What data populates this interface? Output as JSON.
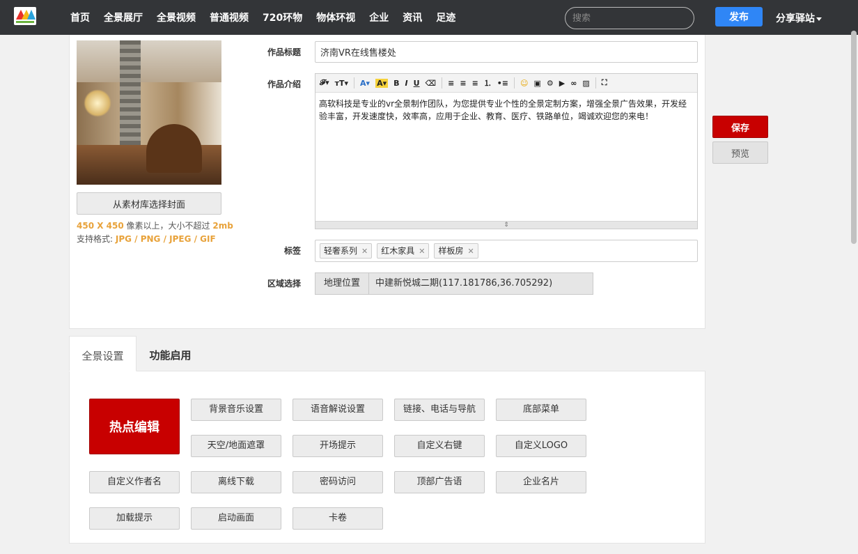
{
  "nav": {
    "items": [
      "首页",
      "全景展厅",
      "全景视频",
      "普通视频",
      "720环物",
      "物体环视",
      "企业",
      "资讯",
      "足迹"
    ],
    "search_placeholder": "搜索",
    "publish_label": "发布",
    "share_label": "分享驿站"
  },
  "cover": {
    "select_label": "从素材库选择封面",
    "size_prefix": "450 X 450",
    "size_mid": " 像素以上，大小不超过 ",
    "size_limit": "2mb",
    "format_prefix": "支持格式: ",
    "formats": "JPG / PNG / JPEG / GIF"
  },
  "form": {
    "title_label": "作品标题",
    "title_value": "济南VR在线售楼处",
    "intro_label": "作品介绍",
    "intro_text": "高软科技是专业的vr全景制作团队，为您提供专业个性的全景定制方案，增强全景广告效果，开发经验丰富，开发速度快，效率高，应用于企业、教育、医疗、铁路单位，竭诚欢迎您的来电！",
    "tags_label": "标签",
    "tags": [
      "轻奢系列",
      "红木家具",
      "样板房"
    ],
    "region_label": "区域选择",
    "geo_key": "地理位置",
    "geo_value": "中建新悦城二期(117.181786,36.705292)"
  },
  "actions": {
    "save_label": "保存",
    "preview_label": "预览"
  },
  "tabs": {
    "tab1": "全景设置",
    "tab2": "功能启用"
  },
  "features": {
    "hotspot": "热点编辑",
    "buttons": [
      "背景音乐设置",
      "语音解说设置",
      "链接、电话与导航",
      "底部菜单",
      "天空/地面遮罩",
      "开场提示",
      "自定义右键",
      "自定义LOGO",
      "自定义作者名",
      "离线下载",
      "密码访问",
      "顶部广告语",
      "企业名片",
      "加载提示",
      "启动画面",
      "卡卷"
    ]
  },
  "colors": {
    "accent_red": "#c80000",
    "accent_blue": "#2f86f6",
    "nav_bg": "#333538",
    "hint_orange": "#e8a23a"
  }
}
